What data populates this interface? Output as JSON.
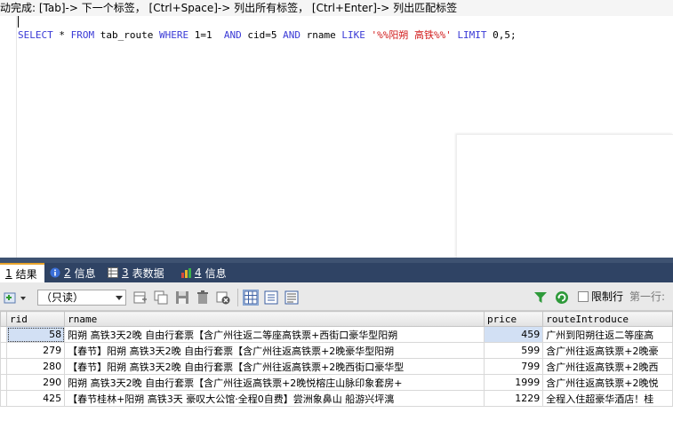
{
  "hint": "动完成: [Tab]-> 下一个标签， [Ctrl+Space]-> 列出所有标签， [Ctrl+Enter]-> 列出匹配标签",
  "sql": {
    "select": "SELECT",
    "star": " * ",
    "from": "FROM",
    "table": " tab_route ",
    "where": "WHERE",
    "cond1": " 1=1  ",
    "and1": "AND",
    "cond2": " cid=5 ",
    "and2": "AND",
    "col": " rname ",
    "like": "LIKE",
    "pattern": " '%%阳朔 高铁%%' ",
    "limit": "LIMIT",
    "limit_val": " 0,5;"
  },
  "tabs": [
    {
      "num": "1",
      "label": " 结果"
    },
    {
      "num": "2",
      "label": " 信息"
    },
    {
      "num": "3",
      "label": " 表数据"
    },
    {
      "num": "4",
      "label": " 信息"
    }
  ],
  "toolbar": {
    "mode_select": "（只读）",
    "limit_rows_label": "限制行",
    "first_row_label": "第一行:"
  },
  "grid": {
    "columns": [
      "rid",
      "rname",
      "price",
      "routeIntroduce"
    ],
    "rows": [
      [
        "58",
        "阳朔 高铁3天2晚 自由行套票【含广州往返二等座高铁票+西街口豪华型阳朔",
        "459",
        "广州到阳朔往返二等座高"
      ],
      [
        "279",
        "【春节】阳朔 高铁3天2晚 自由行套票【含广州往返高铁票+2晚豪华型阳朔",
        "599",
        "含广州往返高铁票+2晚豪"
      ],
      [
        "280",
        "【春节】阳朔 高铁3天2晚 自由行套票【含广州往返高铁票+2晚西街口豪华型",
        "799",
        "含广州往返高铁票+2晚西"
      ],
      [
        "290",
        "阳朔 高铁3天2晚 自由行套票【含广州往返高铁票+2晚悦榕庄山脉印象套房+",
        "1999",
        "含广州往返高铁票+2晚悦"
      ],
      [
        "425",
        "【春节桂林+阳朔 高铁3天 豪叹大公馆·全程0自费】尝洲象鼻山 船游兴坪漓",
        "1229",
        "全程入住超豪华酒店！桂"
      ]
    ]
  },
  "colors": {
    "keyword": "#3a3ad6",
    "string": "#d11a1a",
    "tabbar": "#2f4364",
    "selection": "#d2e0f4"
  }
}
